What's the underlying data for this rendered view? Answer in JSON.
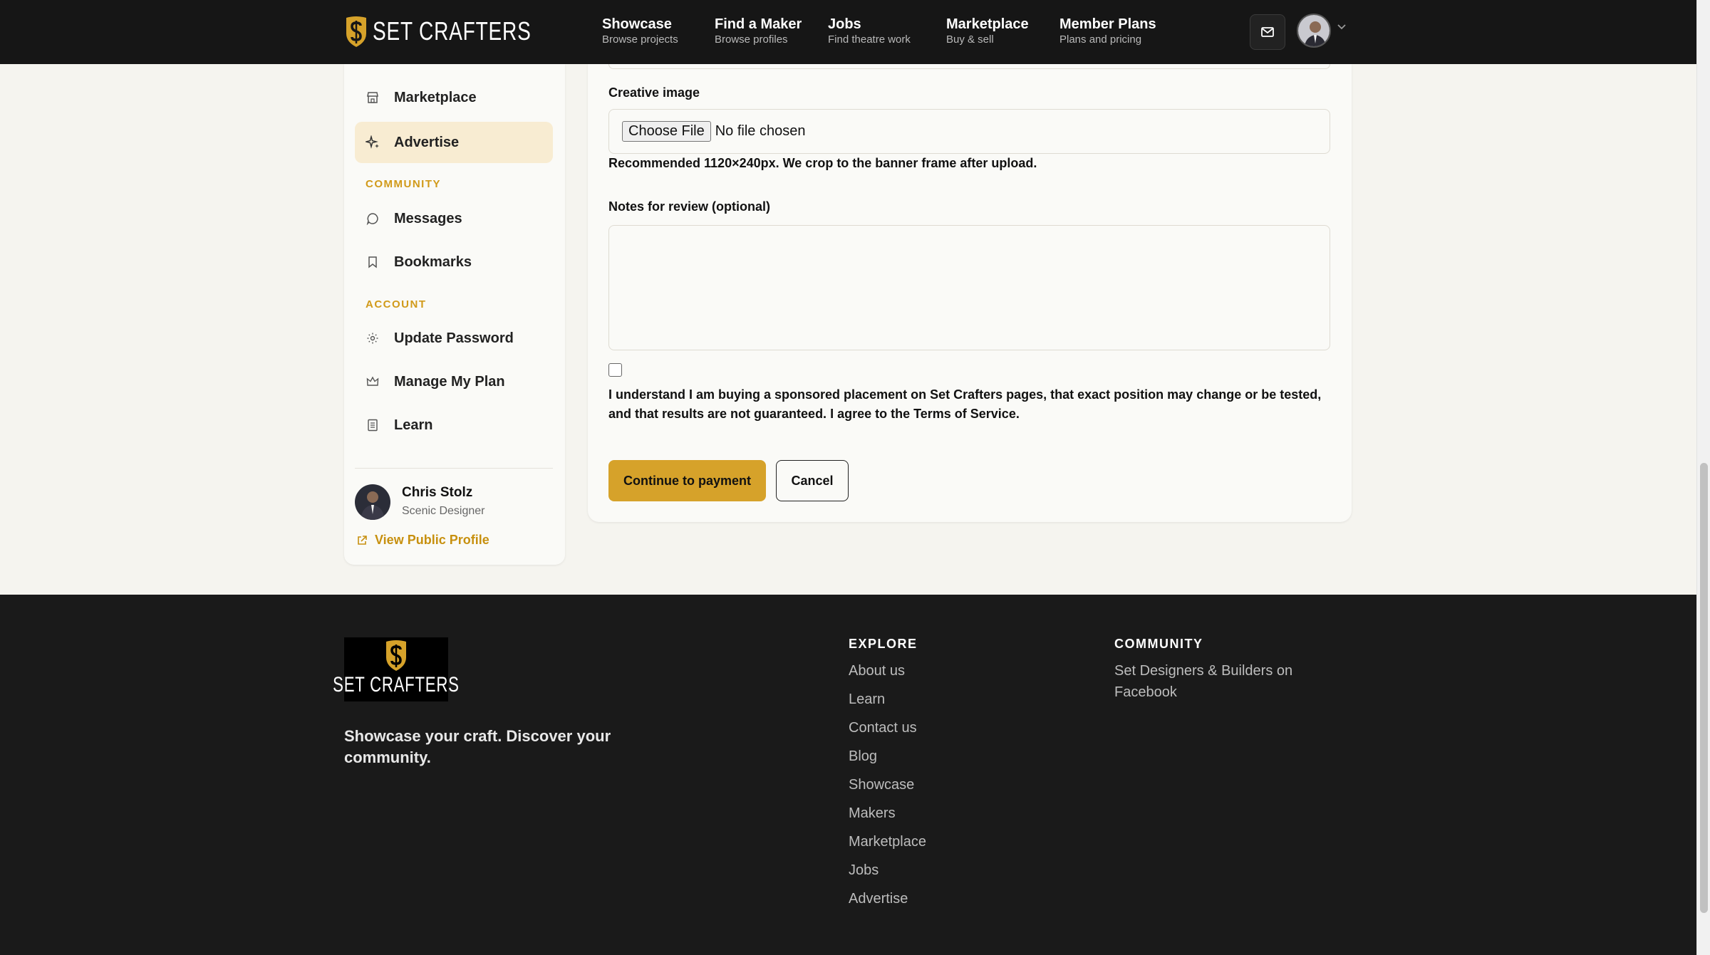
{
  "brand": {
    "name": "SET CRAFTERS"
  },
  "nav": [
    {
      "title": "Showcase",
      "sub": "Browse projects"
    },
    {
      "title": "Find a Maker",
      "sub": "Browse profiles"
    },
    {
      "title": "Jobs",
      "sub": "Find theatre work"
    },
    {
      "title": "Marketplace",
      "sub": "Buy & sell"
    },
    {
      "title": "Member Plans",
      "sub": "Plans and pricing"
    }
  ],
  "sidebar": {
    "items_top": [
      {
        "label": "Marketplace",
        "icon": "storefront-icon"
      },
      {
        "label": "Advertise",
        "icon": "sparkle-icon",
        "active": true
      }
    ],
    "community_heading": "COMMUNITY",
    "community_items": [
      {
        "label": "Messages",
        "icon": "chat-bubble-icon"
      },
      {
        "label": "Bookmarks",
        "icon": "bookmark-icon"
      }
    ],
    "account_heading": "ACCOUNT",
    "account_items": [
      {
        "label": "Update Password",
        "icon": "gear-icon"
      },
      {
        "label": "Manage My Plan",
        "icon": "crown-icon"
      },
      {
        "label": "Learn",
        "icon": "book-icon"
      }
    ],
    "user": {
      "name": "Chris Stolz",
      "role": "Scenic Designer",
      "public_profile_label": "View Public Profile"
    }
  },
  "form": {
    "creative_image_label": "Creative image",
    "file_button_label": "Choose File",
    "file_status": "No file chosen",
    "creative_hint": "Recommended 1120×240px. We crop to the banner frame after upload.",
    "notes_label": "Notes for review (optional)",
    "notes_value": "",
    "agree_text": "I understand I am buying a sponsored placement on Set Crafters pages, that exact position may change or be tested, and that results are not guaranteed. I agree to the Terms of Service.",
    "agree_checked": false,
    "continue_label": "Continue to payment",
    "cancel_label": "Cancel"
  },
  "footer": {
    "brand": "SET CRAFTERS",
    "tagline": "Showcase your craft. Discover your community.",
    "explore_heading": "EXPLORE",
    "explore_links": [
      "About us",
      "Learn",
      "Contact us",
      "Blog",
      "Showcase",
      "Makers",
      "Marketplace",
      "Jobs",
      "Advertise"
    ],
    "community_heading": "COMMUNITY",
    "community_links": [
      "Set Designers & Builders on Facebook"
    ]
  },
  "colors": {
    "accent": "#d6a22a",
    "accent_text": "#c7900f",
    "nav_bg": "#161616",
    "page_bg": "#f5f4ef",
    "active_bg": "#f8ecd2"
  }
}
